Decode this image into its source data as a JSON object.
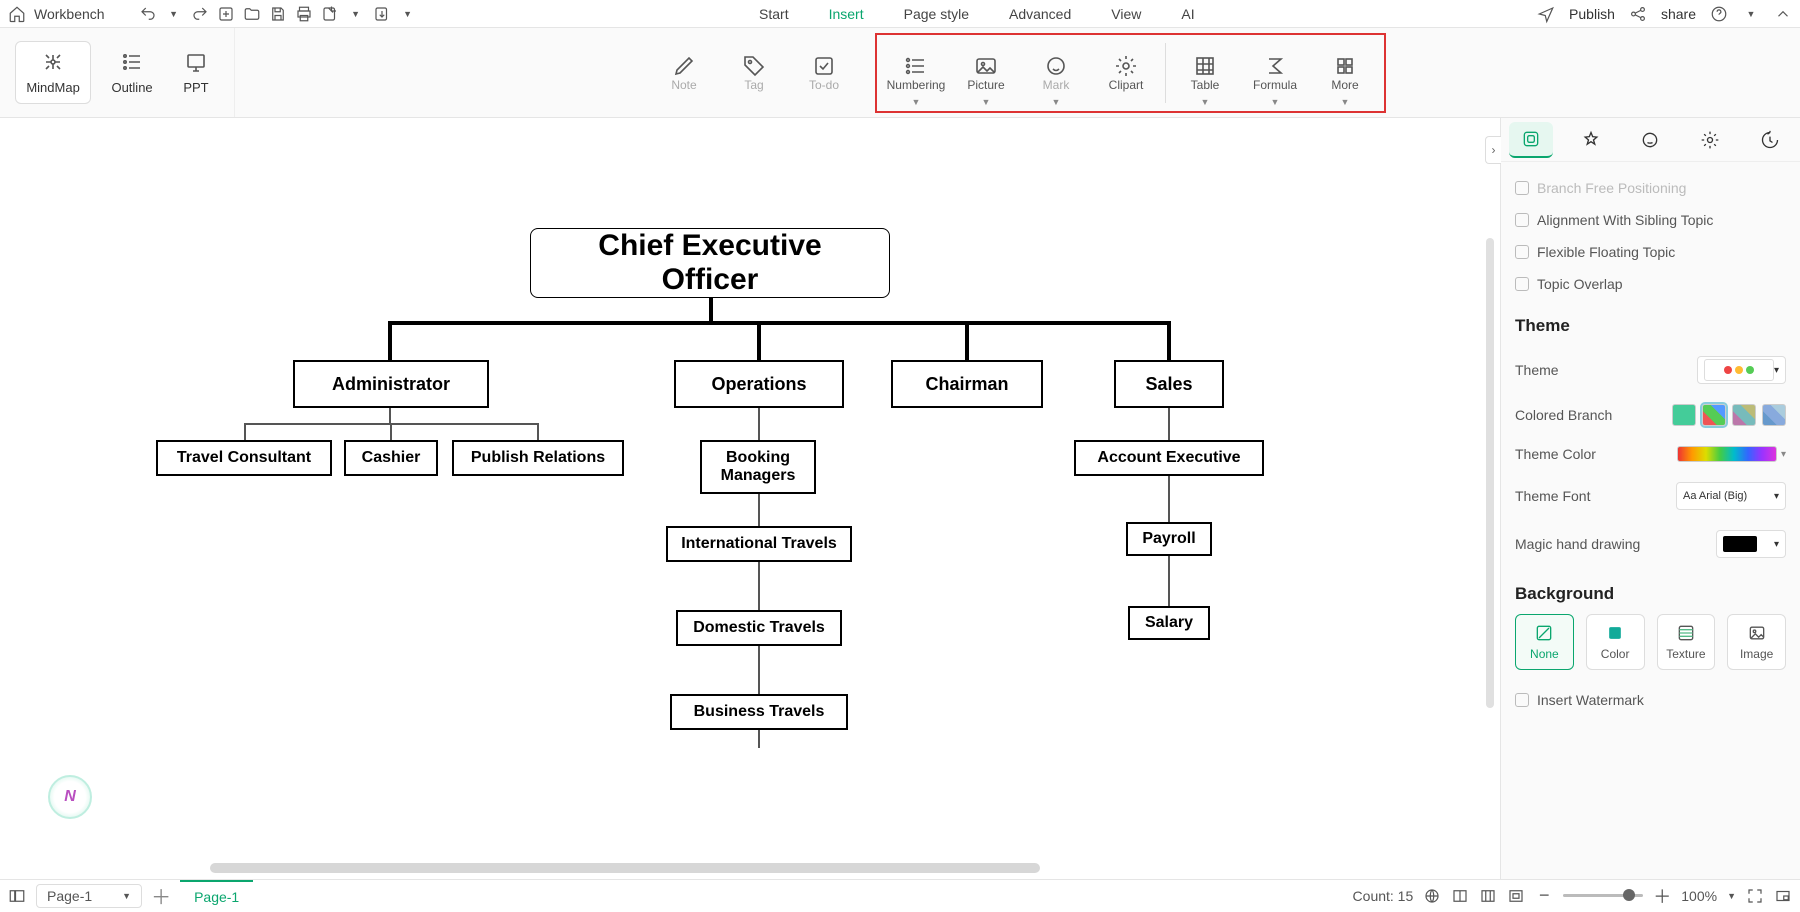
{
  "topbar": {
    "workbench": "Workbench",
    "publish": "Publish",
    "share": "share",
    "tabs": [
      "Start",
      "Insert",
      "Page style",
      "Advanced",
      "View",
      "AI"
    ],
    "active_tab": 1
  },
  "toolbar": {
    "views": [
      {
        "label": "MindMap"
      },
      {
        "label": "Outline"
      },
      {
        "label": "PPT"
      }
    ],
    "view_active": 0,
    "left_tools": [
      {
        "label": "Note"
      },
      {
        "label": "Tag"
      },
      {
        "label": "To-do"
      }
    ],
    "highlight_tools": [
      {
        "label": "Numbering"
      },
      {
        "label": "Picture"
      },
      {
        "label": "Mark"
      },
      {
        "label": "Clipart"
      },
      {
        "label": "Table"
      },
      {
        "label": "Formula"
      },
      {
        "label": "More"
      }
    ]
  },
  "org": {
    "root": "Chief Executive Officer",
    "level1": [
      "Administrator",
      "Operations",
      "Chairman",
      "Sales"
    ],
    "admin_children": [
      "Travel Consultant",
      "Cashier",
      "Publish Relations"
    ],
    "ops_children": [
      "Booking Managers",
      "International Travels",
      "Domestic Travels",
      "Business Travels"
    ],
    "sales_children": [
      "Account Executive",
      "Payroll",
      "Salary"
    ]
  },
  "panel": {
    "checks": [
      "Branch Free Positioning",
      "Alignment With Sibling Topic",
      "Flexible Floating Topic",
      "Topic Overlap"
    ],
    "theme_title": "Theme",
    "theme_label": "Theme",
    "colored_branch": "Colored Branch",
    "theme_color": "Theme Color",
    "theme_font_label": "Theme Font",
    "theme_font_value": "Arial (Big)",
    "magic_hand": "Magic hand drawing",
    "bg_title": "Background",
    "bg_options": [
      "None",
      "Color",
      "Texture",
      "Image"
    ],
    "insert_watermark": "Insert Watermark"
  },
  "bottom": {
    "page_sel": "Page-1",
    "page_tab": "Page-1",
    "count_label": "Count: 15",
    "zoom": "100%"
  }
}
